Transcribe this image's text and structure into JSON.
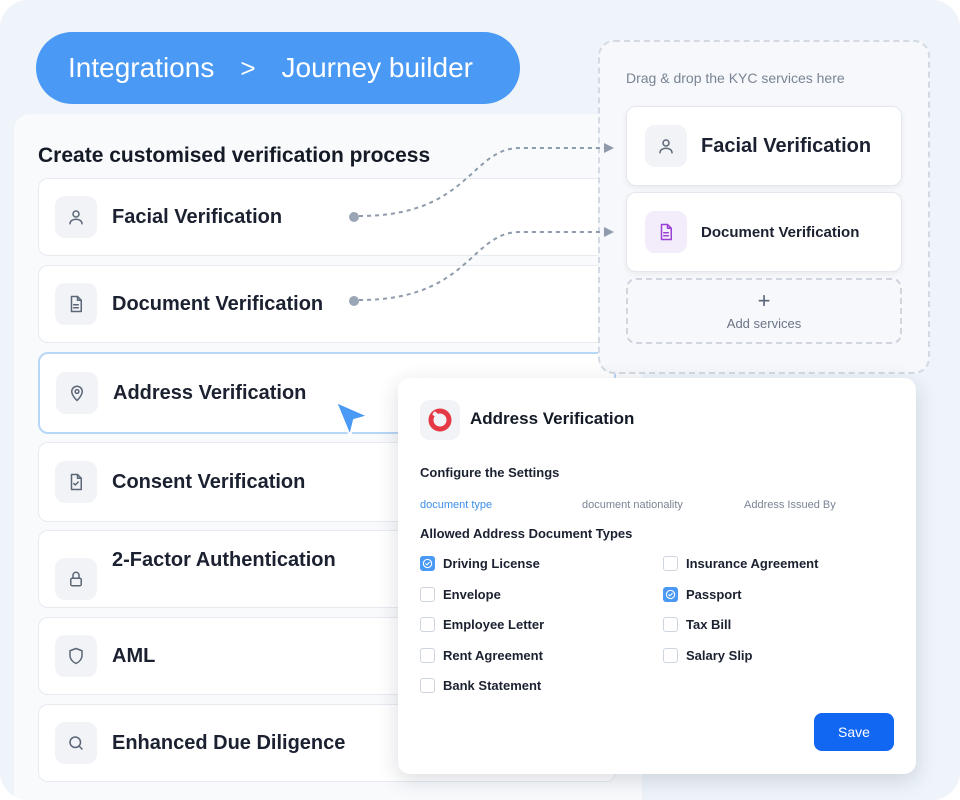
{
  "breadcrumb": {
    "root": "Integrations",
    "separator": ">",
    "current": "Journey builder"
  },
  "builder": {
    "title": "Create customised verification process",
    "services": [
      {
        "label": "Facial Verification",
        "icon": "user-icon"
      },
      {
        "label": "Document Verification",
        "icon": "document-icon"
      },
      {
        "label": "Address Verification",
        "icon": "location-pin-icon",
        "selected": true
      },
      {
        "label": "Consent Verification",
        "icon": "clipboard-check-icon"
      },
      {
        "label": "2-Factor Authentication",
        "icon": "lock-icon"
      },
      {
        "label": "AML",
        "icon": "shield-icon"
      },
      {
        "label": "Enhanced Due Diligence",
        "icon": "search-icon"
      }
    ]
  },
  "dropzone": {
    "hint": "Drag & drop the KYC services here",
    "items": [
      {
        "label": "Facial Verification",
        "icon": "user-icon"
      },
      {
        "label": "Document Verification",
        "icon": "document-icon",
        "icon_color": "#9b3fd6"
      }
    ],
    "add_label": "Add services",
    "add_symbol": "+"
  },
  "config": {
    "title": "Address Verification",
    "logo_color": "#e63946",
    "configure_label": "Configure the Settings",
    "tabs": [
      {
        "label": "document type",
        "active": true
      },
      {
        "label": "document nationality",
        "active": false
      },
      {
        "label": "Address Issued By",
        "active": false
      }
    ],
    "allowed_title": "Allowed Address Document Types",
    "options": [
      {
        "label": "Driving License",
        "checked": true
      },
      {
        "label": "Envelope",
        "checked": false
      },
      {
        "label": "Employee Letter",
        "checked": false
      },
      {
        "label": "Rent Agreement",
        "checked": false
      },
      {
        "label": "Bank Statement",
        "checked": false
      },
      {
        "label": "Insurance Agreement",
        "checked": false
      },
      {
        "label": "Passport",
        "checked": true
      },
      {
        "label": "Tax Bill",
        "checked": false
      },
      {
        "label": "Salary Slip",
        "checked": false
      }
    ],
    "save_label": "Save",
    "accent": "#1166f2"
  }
}
